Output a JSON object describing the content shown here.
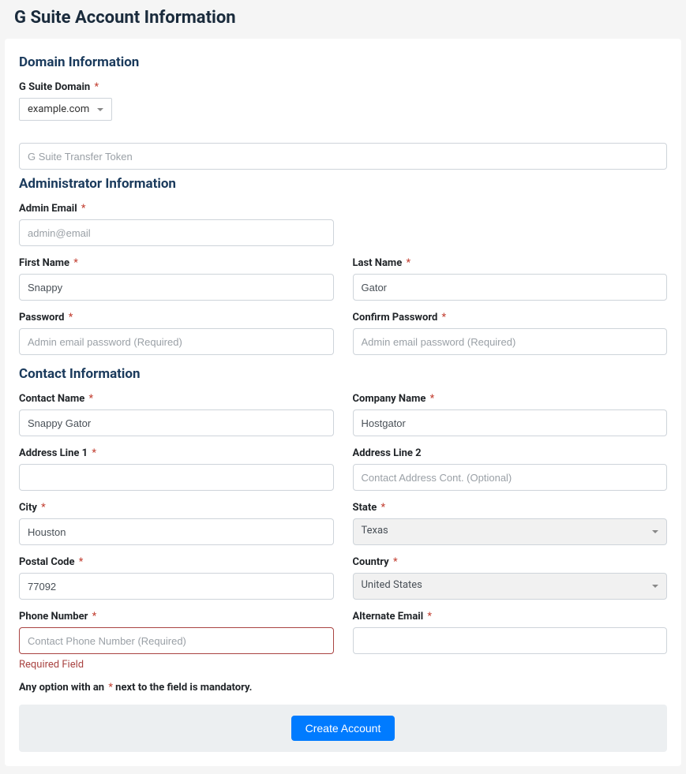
{
  "page": {
    "title": "G Suite Account Information"
  },
  "sections": {
    "domain": {
      "title": "Domain Information",
      "fields": {
        "domain_label": "G Suite Domain",
        "domain_value": "example.com",
        "transfer_token_placeholder": "G Suite Transfer Token"
      }
    },
    "admin": {
      "title": "Administrator Information",
      "fields": {
        "admin_email_label": "Admin Email",
        "admin_email_placeholder": "admin@email",
        "first_name_label": "First Name",
        "first_name_value": "Snappy",
        "last_name_label": "Last Name",
        "last_name_value": "Gator",
        "password_label": "Password",
        "password_placeholder": "Admin email password (Required)",
        "confirm_password_label": "Confirm Password",
        "confirm_password_placeholder": "Admin email password (Required)"
      }
    },
    "contact": {
      "title": "Contact Information",
      "fields": {
        "contact_name_label": "Contact Name",
        "contact_name_value": "Snappy Gator",
        "company_name_label": "Company Name",
        "company_name_value": "Hostgator",
        "address1_label": "Address Line 1",
        "address1_value": "",
        "address2_label": "Address Line 2",
        "address2_placeholder": "Contact Address Cont. (Optional)",
        "city_label": "City",
        "city_value": "Houston",
        "state_label": "State",
        "state_value": "Texas",
        "postal_label": "Postal Code",
        "postal_value": "77092",
        "country_label": "Country",
        "country_value": "United States",
        "phone_label": "Phone Number",
        "phone_placeholder": "Contact Phone Number (Required)",
        "phone_error": "Required Field",
        "alt_email_label": "Alternate Email",
        "alt_email_value": ""
      }
    }
  },
  "footer": {
    "mandatory_prefix": "Any option with an",
    "mandatory_suffix": "next to the field is mandatory.",
    "submit_label": "Create Account"
  },
  "required_star": "*"
}
